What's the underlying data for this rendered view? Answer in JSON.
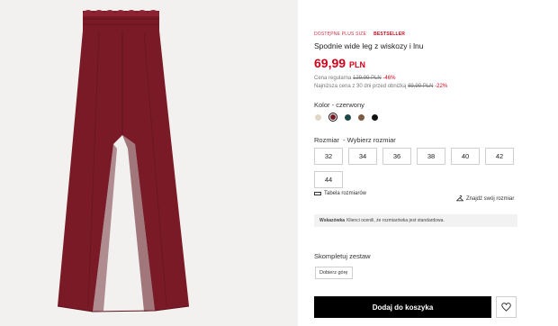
{
  "product": {
    "badge_plus": "DOSTĘPNE PLUS SIZE",
    "badge_best": "BESTSELLER",
    "title": "Spodnie wide leg z wiskozy i lnu",
    "price": "69,99",
    "currency": "PLN",
    "regular_label": "Cena regularna",
    "regular_price": "129,99 PLN",
    "regular_discount": "-46%",
    "lowest_label": "Najniższa cena z 30 dni przed obniżką",
    "lowest_price": "89,99 PLN",
    "lowest_discount": "-22%",
    "image_alt": "Czerwone spodnie wide leg",
    "colors": {
      "fabric": "#7a1a26",
      "fabric_dark": "#5e121c",
      "fabric_light": "#8c2332",
      "background": "#f2f1ef",
      "accent": "#d0021b"
    }
  },
  "color": {
    "label": "Kolor",
    "selected": "czerwony",
    "swatches": [
      "#e3d8c8",
      "#7a1a26",
      "#1e4b4a",
      "#7a5a42",
      "#111111"
    ],
    "selected_index": 1
  },
  "size": {
    "label": "Rozmiar",
    "prompt": "Wybierz rozmiar",
    "options": [
      "32",
      "34",
      "36",
      "38",
      "40",
      "42",
      "44"
    ]
  },
  "links": {
    "size_table": "Tabela rozmiarów",
    "find_size": "Znajdź swój rozmiar"
  },
  "hint": {
    "title": "Wskazówka",
    "text": "Klienci ocenili, że rozmiarówka jest standardowa."
  },
  "set": {
    "label": "Skompletuj zestaw",
    "button": "Dobierz górę"
  },
  "cart": {
    "add_label": "Dodaj do koszyka"
  },
  "icons": [
    "ruler-icon",
    "hanger-icon",
    "heart-icon"
  ]
}
